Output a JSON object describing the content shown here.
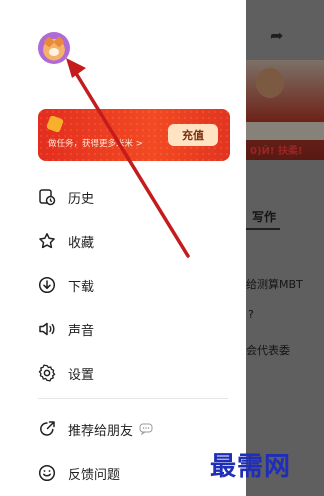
{
  "background": {
    "photo_text": "0)Ӣ! 扶柔!",
    "lines": [
      "写作",
      "给测算MBT",
      "?",
      "会代表委"
    ]
  },
  "promo": {
    "text": "做任务，获得更多米米 >",
    "button": "充值"
  },
  "menu": [
    {
      "label": "历史",
      "icon": "history-icon"
    },
    {
      "label": "收藏",
      "icon": "star-icon"
    },
    {
      "label": "下载",
      "icon": "download-icon"
    },
    {
      "label": "声音",
      "icon": "speaker-icon"
    },
    {
      "label": "设置",
      "icon": "gear-icon"
    },
    {
      "label": "推荐给朋友",
      "icon": "share-icon"
    },
    {
      "label": "反馈问题",
      "icon": "feedback-icon"
    }
  ],
  "watermark": "最需网",
  "colors": {
    "accent": "#e32d1e",
    "arrow": "#c41c1c",
    "watermark": "#1f2eb8"
  }
}
